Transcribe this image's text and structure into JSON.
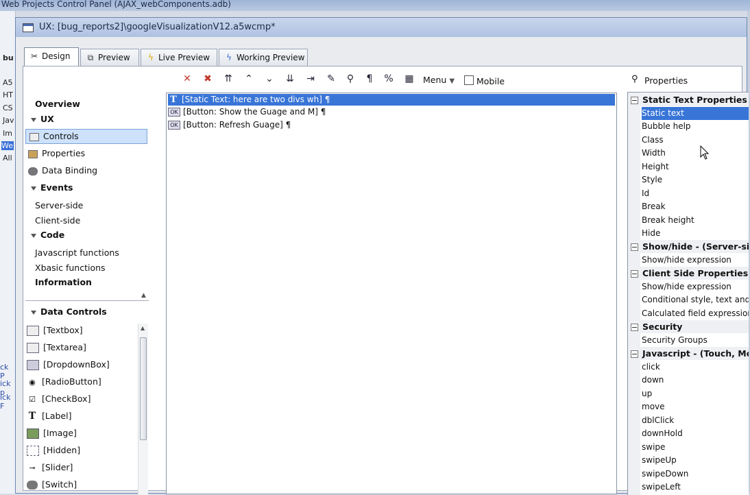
{
  "background": {
    "title": "Web Projects Control Panel (AJAX_webComponents.adb)",
    "toolbar_frag": "bu",
    "side_items": [
      "A5",
      "HT",
      "CS",
      "Jav",
      "Im",
      "We",
      "All"
    ],
    "side_links": [
      "ck P",
      "ick p",
      "ick F"
    ]
  },
  "window": {
    "title": "UX: [bug_reports2]\\googleVisualizationV12.a5wcmp*"
  },
  "tabs": [
    {
      "label": "Design",
      "icon": "design-icon"
    },
    {
      "label": "Preview",
      "icon": "preview-icon"
    },
    {
      "label": "Live Preview",
      "icon": "lightning-icon"
    },
    {
      "label": "Working Preview",
      "icon": "lightning-icon"
    }
  ],
  "toolbar": {
    "menu_label": "Menu",
    "mobile_label": "Mobile",
    "properties_label": "Properties",
    "pilcrow": "¶",
    "percent": "%"
  },
  "nav": {
    "overview": "Overview",
    "ux": "UX",
    "controls": "Controls",
    "properties": "Properties",
    "data_binding": "Data Binding",
    "events": "Events",
    "server_side": "Server-side",
    "client_side": "Client-side",
    "code": "Code",
    "js_functions": "Javascript functions",
    "xbasic_functions": "Xbasic functions",
    "information": "Information"
  },
  "data_controls": {
    "header": "Data Controls",
    "items": [
      "[Textbox]",
      "[Textarea]",
      "[DropdownBox]",
      "[RadioButton]",
      "[CheckBox]",
      "[Label]",
      "[Image]",
      "[Hidden]",
      "[Slider]",
      "[Switch]"
    ]
  },
  "tree_rows": [
    "[Static Text: here are two divs wh] ¶",
    "[Button: Show the Guage and M] ¶",
    "[Button: Refresh Guage] ¶"
  ],
  "props": {
    "groups": [
      {
        "title": "Static Text Properties",
        "items": [
          "Static text",
          "Bubble help",
          "Class",
          "Width",
          "Height",
          "Style",
          "Id",
          "Break",
          "Break height",
          "Hide"
        ]
      },
      {
        "title": "Show/hide - (Server-side",
        "items": [
          "Show/hide expression"
        ]
      },
      {
        "title": "Client Side Properties",
        "items": [
          "Show/hide expression",
          "Conditional style, text and eve",
          "Calculated field expression"
        ]
      },
      {
        "title": "Security",
        "items": [
          "Security Groups"
        ]
      },
      {
        "title": "Javascript - (Touch, Mou",
        "items": [
          "click",
          "down",
          "up",
          "move",
          "dblClick",
          "downHold",
          "swipe",
          "swipeUp",
          "swipeDown",
          "swipeLeft"
        ]
      }
    ]
  },
  "colors": {
    "selection": "#3875d7",
    "accent": "#cde1fa"
  }
}
